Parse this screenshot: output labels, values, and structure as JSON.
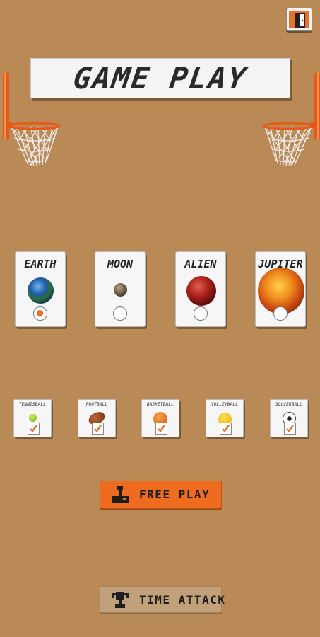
{
  "header": {
    "title": "GAME PLAY",
    "exit_icon": "exit-door-icon"
  },
  "planets": [
    {
      "label": "EARTH",
      "selected": true
    },
    {
      "label": "MOON",
      "selected": false
    },
    {
      "label": "ALIEN",
      "selected": false
    },
    {
      "label": "JUPITER",
      "selected": false
    }
  ],
  "balls": [
    {
      "label": "TENNISBALL",
      "checked": true
    },
    {
      "label": "FOOTBALL",
      "checked": true
    },
    {
      "label": "BASKETBALL",
      "checked": true
    },
    {
      "label": "VOLLEYBALL",
      "checked": true
    },
    {
      "label": "SOCCERBALL",
      "checked": true
    }
  ],
  "buttons": {
    "free_play": "FREE PLAY",
    "time_attack": "TIME ATTACK"
  },
  "colors": {
    "background": "#b98a56",
    "accent": "#ef6b20",
    "secondary_button": "#c1a07a"
  }
}
